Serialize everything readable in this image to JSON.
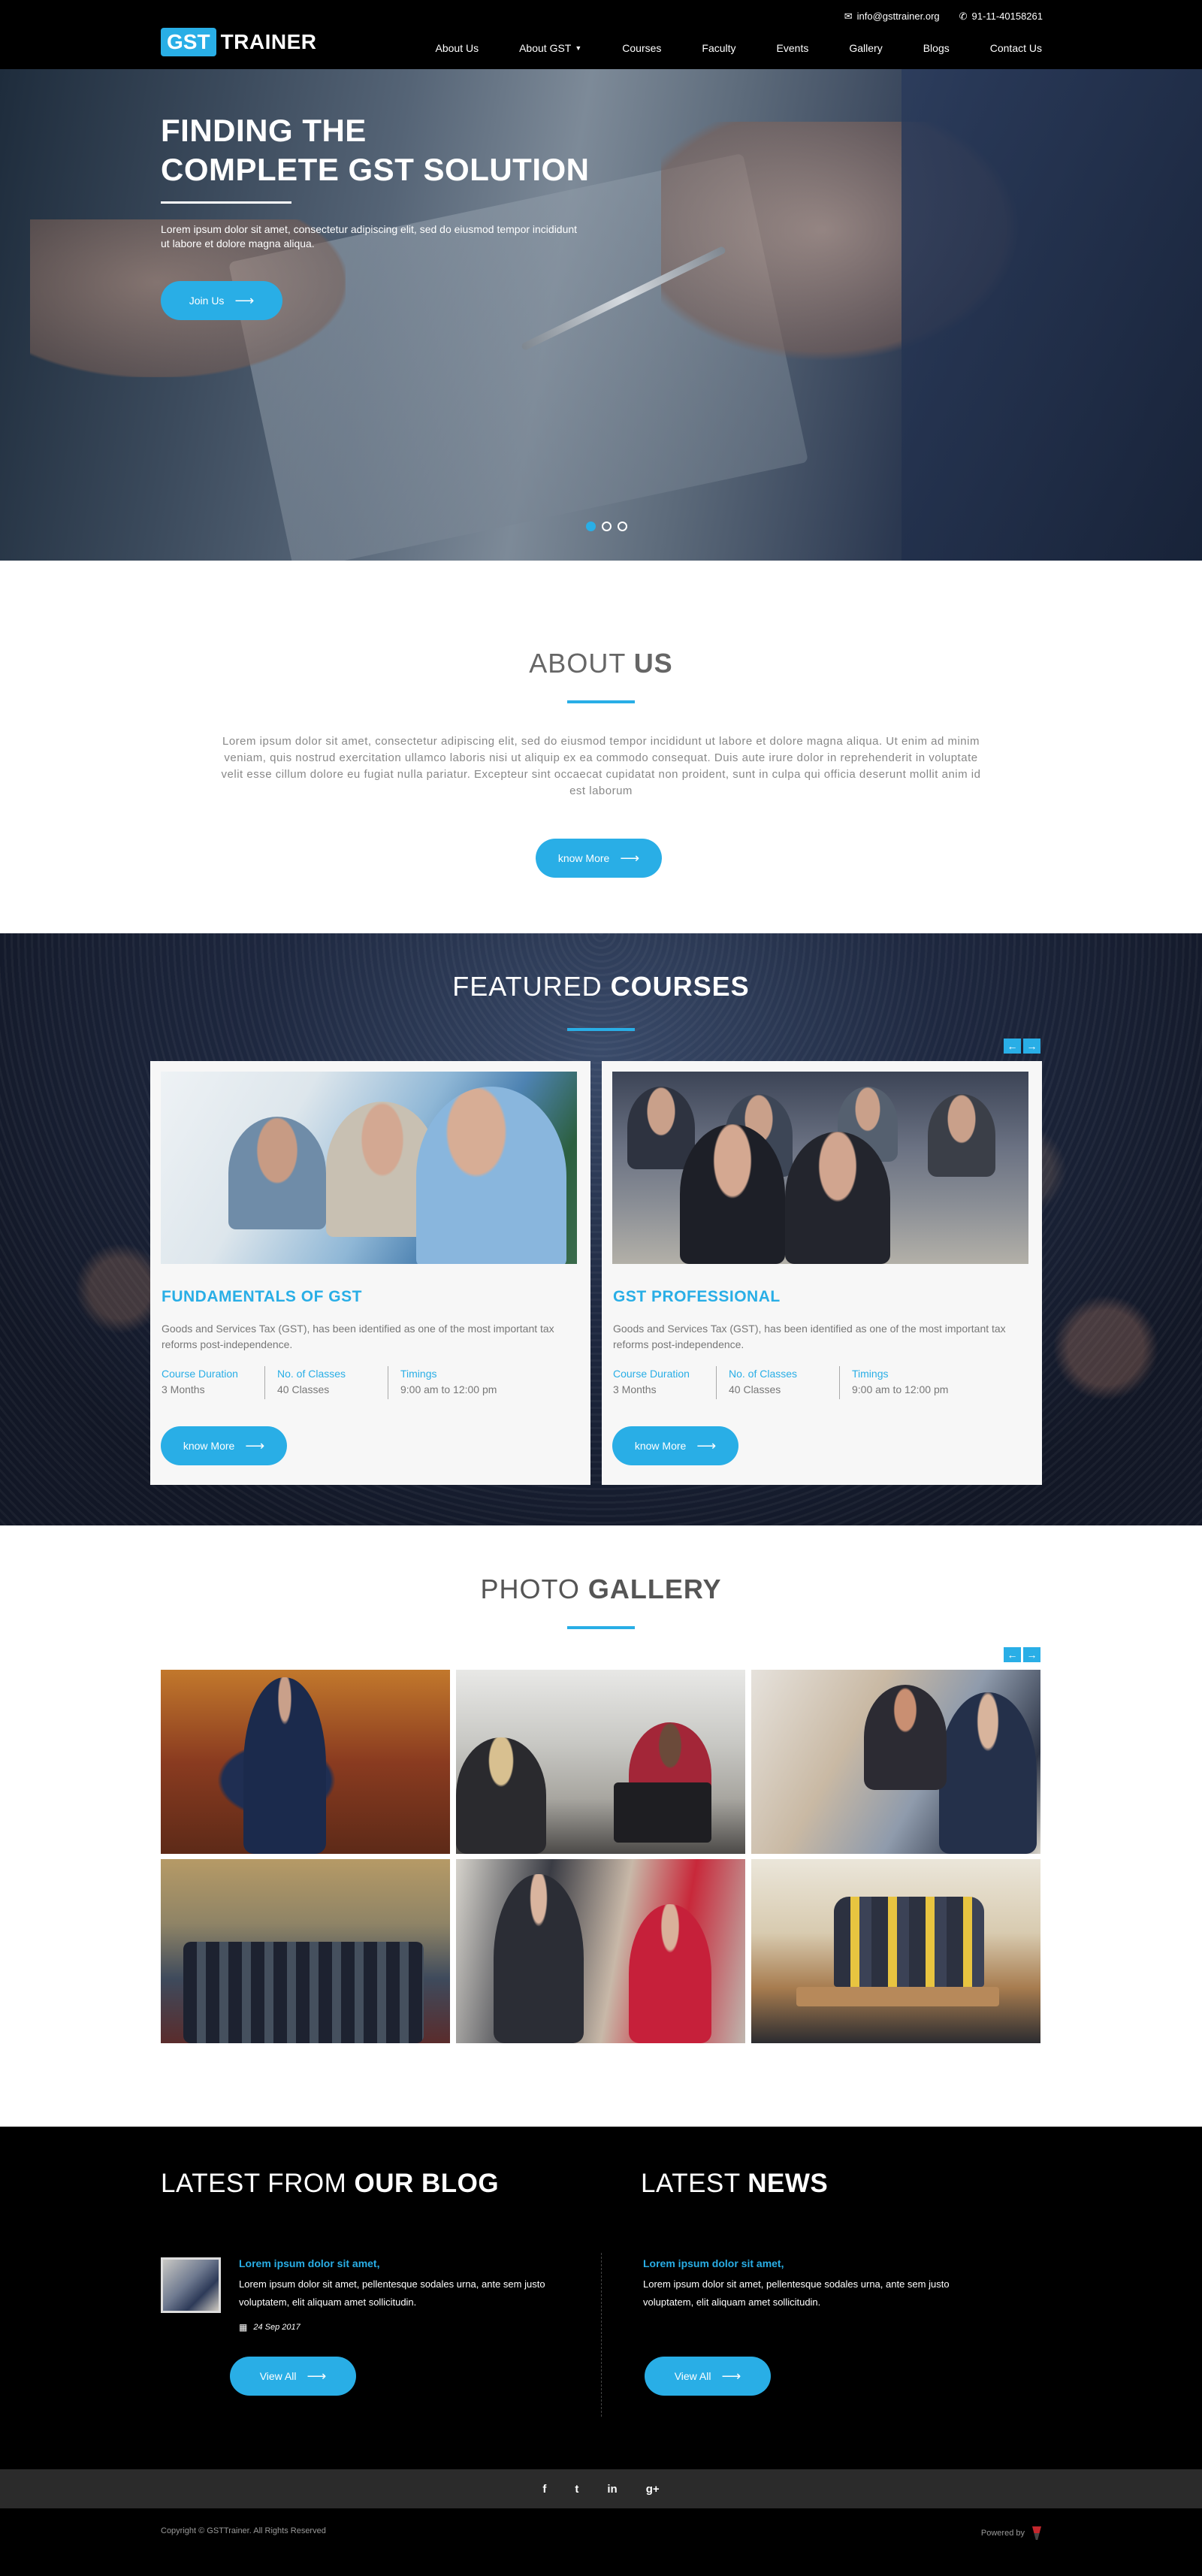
{
  "header": {
    "logo_box": "GST",
    "logo_rest": "TRAINER",
    "email": "info@gsttrainer.org",
    "phone": "91-11-40158261",
    "nav": [
      "About Us",
      "About GST",
      "Courses",
      "Faculty",
      "Events",
      "Gallery",
      "Blogs",
      "Contact Us"
    ]
  },
  "hero": {
    "title_line1": "FINDING THE",
    "title_line2": "COMPLETE GST SOLUTION",
    "text": "Lorem ipsum dolor sit amet, consectetur adipiscing elit, sed do eiusmod tempor incididunt ut labore et dolore magna aliqua.",
    "button": "Join Us",
    "slides": 3,
    "active_slide": 1
  },
  "about": {
    "title_light": "ABOUT",
    "title_bold": "US",
    "text": "Lorem ipsum dolor sit amet, consectetur adipiscing elit, sed do eiusmod tempor incididunt ut labore et dolore magna aliqua. Ut enim ad minim veniam, quis nostrud exercitation ullamco laboris nisi ut aliquip ex ea commodo consequat. Duis aute irure dolor in reprehenderit in voluptate velit esse cillum dolore eu fugiat nulla pariatur. Excepteur sint occaecat cupidatat non proident, sunt in culpa qui officia deserunt mollit anim id est laborum",
    "button": "know More"
  },
  "courses": {
    "title_light": "FEATURED",
    "title_bold": "COURSES",
    "items": [
      {
        "title": "FUNDAMENTALS OF GST",
        "desc": "Goods and Services Tax (GST), has been identified as one of the most important tax reforms post-independence.",
        "duration_label": "Course Duration",
        "duration": "3 Months",
        "classes_label": "No. of Classes",
        "classes": "40 Classes",
        "timings_label": "Timings",
        "timings": "9:00 am to 12:00 pm",
        "button": "know More"
      },
      {
        "title": "GST PROFESSIONAL",
        "desc": "Goods and Services Tax (GST), has been identified as one of the most important tax reforms post-independence.",
        "duration_label": "Course Duration",
        "duration": "3 Months",
        "classes_label": "No. of Classes",
        "classes": "40 Classes",
        "timings_label": "Timings",
        "timings": "9:00 am to 12:00 pm",
        "button": "know More"
      }
    ]
  },
  "gallery": {
    "title_light": "PHOTO",
    "title_bold": "GALLERY"
  },
  "blog": {
    "title_light": "LATEST FROM",
    "title_bold": "OUR BLOG",
    "post_title": "Lorem ipsum dolor sit amet,",
    "post_text": "Lorem ipsum dolor sit amet, pellentesque sodales urna, ante sem justo voluptatem, elit aliquam amet sollicitudin.",
    "date": "24 Sep 2017",
    "button": "View All"
  },
  "news": {
    "title_light": "LATEST",
    "title_bold": "NEWS",
    "post_title": "Lorem ipsum dolor sit amet,",
    "post_text": "Lorem ipsum dolor sit amet, pellentesque sodales urna, ante sem justo voluptatem, elit aliquam amet sollicitudin.",
    "button": "View All"
  },
  "social": [
    "f",
    "t",
    "in",
    "g+"
  ],
  "footer": {
    "copyright": "Copyright © GSTTrainer. All Rights Reserved",
    "powered": "Powered by"
  },
  "colors": {
    "accent": "#29aee6",
    "dark": "#000000"
  }
}
